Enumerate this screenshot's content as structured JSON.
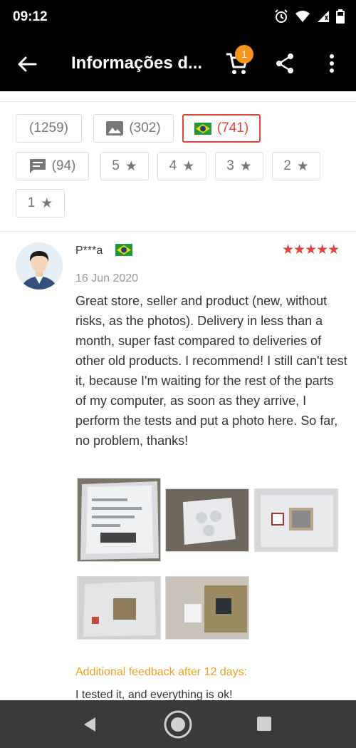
{
  "status_bar": {
    "time": "09:12",
    "icons": [
      "alarm-icon",
      "wifi-icon",
      "signal-icon",
      "battery-icon"
    ]
  },
  "app_bar": {
    "title": "Informações d...",
    "cart_count": "1",
    "icons": [
      "back-arrow-icon",
      "cart-icon",
      "share-icon",
      "more-vertical-icon"
    ]
  },
  "filters": {
    "all": "(1259)",
    "photos": "(302)",
    "country": "(741)",
    "comments": "(94)",
    "star_5": "5",
    "star_4": "4",
    "star_3": "3",
    "star_2": "2",
    "star_1": "1",
    "star_glyph": "★",
    "selected": "country"
  },
  "review": {
    "reviewer": "P***a",
    "rating": 5,
    "stars_text": "★★★★★",
    "date": "16 Jun 2020",
    "text": "Great store, seller and product (new, without risks, as the photos). Delivery in less than a month, super fast compared to deliveries of other old products. I recommend!  I still can't test it, because I'm waiting for the rest of the parts of my computer, as soon as they arrive, I perform the tests and put a photo here.  So far, no problem, thanks!",
    "additional_label": "Additional feedback after 12 days:",
    "additional_text": "I tested it, and everything is ok!"
  },
  "colors": {
    "accent": "#e0453a",
    "badge": "#f7941d",
    "additional": "#f0a020",
    "appbar": "#000000",
    "navbar": "#3a3a3a"
  }
}
